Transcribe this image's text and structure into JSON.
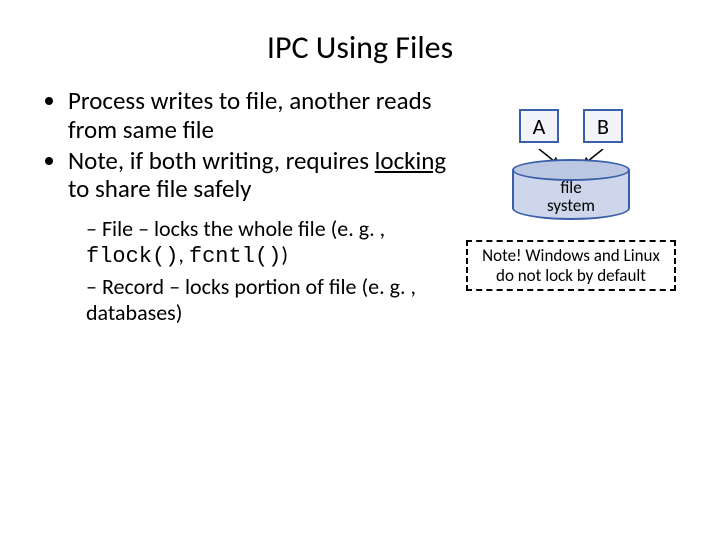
{
  "title": "IPC Using Files",
  "bullets": {
    "b1": "Process writes to file, another reads from same file",
    "b2a": "Note, if both writing, requires ",
    "b2b": "locking",
    "b2c": " to share file safely",
    "s1a": "File – locks the whole file (e. g. , ",
    "s1b": "flock()",
    "s1c": ", ",
    "s1d": "fcntl()",
    "s1e": ")",
    "s2": "Record – locks portion of file (e. g. , databases)"
  },
  "diagram": {
    "boxA": "A",
    "boxB": "B",
    "cyl_line1": "file",
    "cyl_line2": "system"
  },
  "note": "Note! Windows and Linux do not lock by default"
}
